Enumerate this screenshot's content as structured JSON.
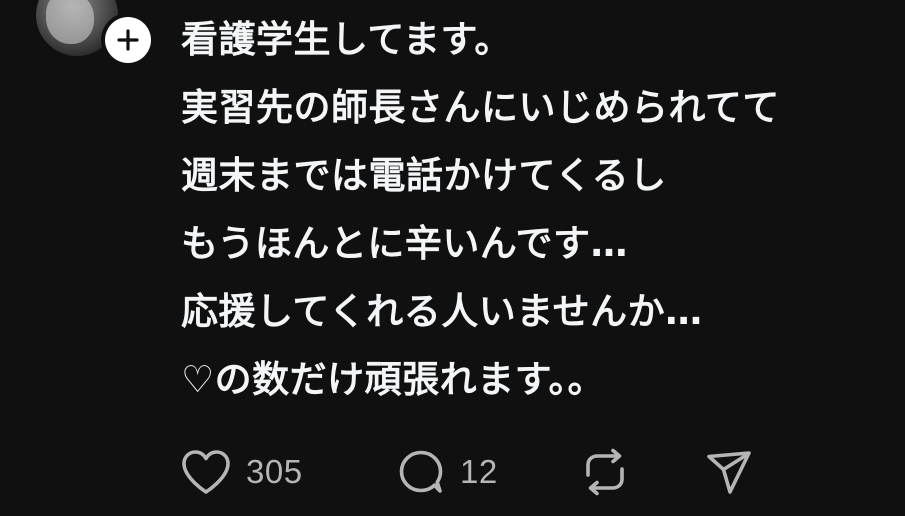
{
  "post": {
    "lines": [
      "看護学生してます。",
      "実習先の師長さんにいじめられてて",
      "週末までは電話かけてくるし",
      "もうほんとに辛いんです…",
      "応援してくれる人いませんか…",
      "♡の数だけ頑張れます。。"
    ]
  },
  "actions": {
    "like_count": "305",
    "reply_count": "12"
  },
  "icons": {
    "follow": "plus-icon",
    "like": "heart-icon",
    "reply": "speech-bubble-icon",
    "repost": "repost-icon",
    "share": "send-icon"
  },
  "colors": {
    "background": "#101010",
    "text": "#f3f5f7",
    "muted": "#b5b5b5"
  }
}
